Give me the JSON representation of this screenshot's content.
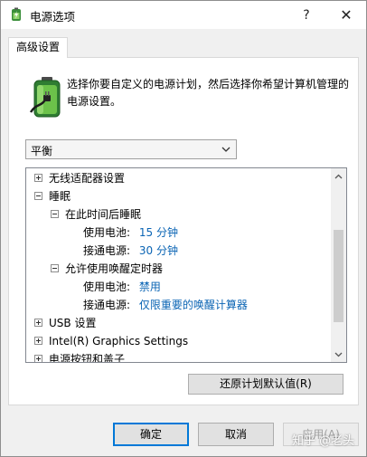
{
  "window": {
    "title": "电源选项",
    "help_glyph": "?",
    "close_glyph": "✕"
  },
  "tabs": [
    {
      "label": "高级设置",
      "selected": true
    }
  ],
  "header": {
    "description": "选择你要自定义的电源计划，然后选择你希望计算机管理的电源设置。",
    "icon": "battery-power-icon"
  },
  "plan_select": {
    "value": "平衡"
  },
  "tree": {
    "items": [
      {
        "label": "无线适配器设置",
        "state": "collapsed"
      },
      {
        "label": "睡眠",
        "state": "expanded"
      },
      {
        "label": "在此时间后睡眠",
        "state": "expanded"
      },
      {
        "label": "使用电池:",
        "value": "15 分钟"
      },
      {
        "label": "接通电源:",
        "value": "30 分钟"
      },
      {
        "label": "允许使用唤醒定时器",
        "state": "expanded"
      },
      {
        "label": "使用电池:",
        "value": "禁用"
      },
      {
        "label": "接通电源:",
        "value": "仅限重要的唤醒计算器"
      },
      {
        "label": "USB 设置",
        "state": "collapsed"
      },
      {
        "label": "Intel(R) Graphics Settings",
        "state": "collapsed"
      },
      {
        "label": "电源按钮和盖子",
        "state": "collapsed"
      }
    ]
  },
  "buttons": {
    "restore": "还原计划默认值(R)",
    "ok": "确定",
    "cancel": "取消",
    "apply": "应用(A)"
  },
  "watermark": "知乎 @老头",
  "colors": {
    "value_link": "#0a64b4",
    "focus_border": "#0078d7"
  }
}
